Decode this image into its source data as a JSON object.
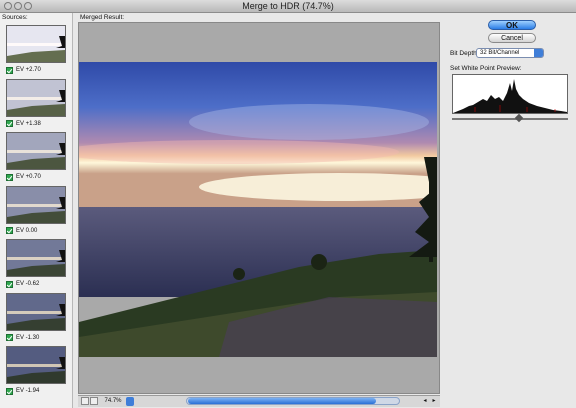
{
  "window": {
    "title": "Merge to HDR (74.7%)"
  },
  "sources": {
    "label": "Sources:",
    "items": [
      {
        "ev": "EV +2.70",
        "brightness": 1.0
      },
      {
        "ev": "EV +1.38",
        "brightness": 0.78
      },
      {
        "ev": "EV +0.70",
        "brightness": 0.6
      },
      {
        "ev": "EV 0.00",
        "brightness": 0.45
      },
      {
        "ev": "EV -0.62",
        "brightness": 0.32
      },
      {
        "ev": "EV -1.30",
        "brightness": 0.22
      },
      {
        "ev": "EV -1.94",
        "brightness": 0.14
      }
    ]
  },
  "preview": {
    "label": "Merged Result:",
    "zoom": "74.7%"
  },
  "buttons": {
    "ok": "OK",
    "cancel": "Cancel"
  },
  "bit_depth": {
    "label": "Bit Depth:",
    "value": "32 Bit/Channel"
  },
  "white_point": {
    "label": "Set White Point Preview:",
    "slider_value": 0.58
  },
  "colors": {
    "accent": "#2b7de6",
    "check": "#2fa84f"
  }
}
